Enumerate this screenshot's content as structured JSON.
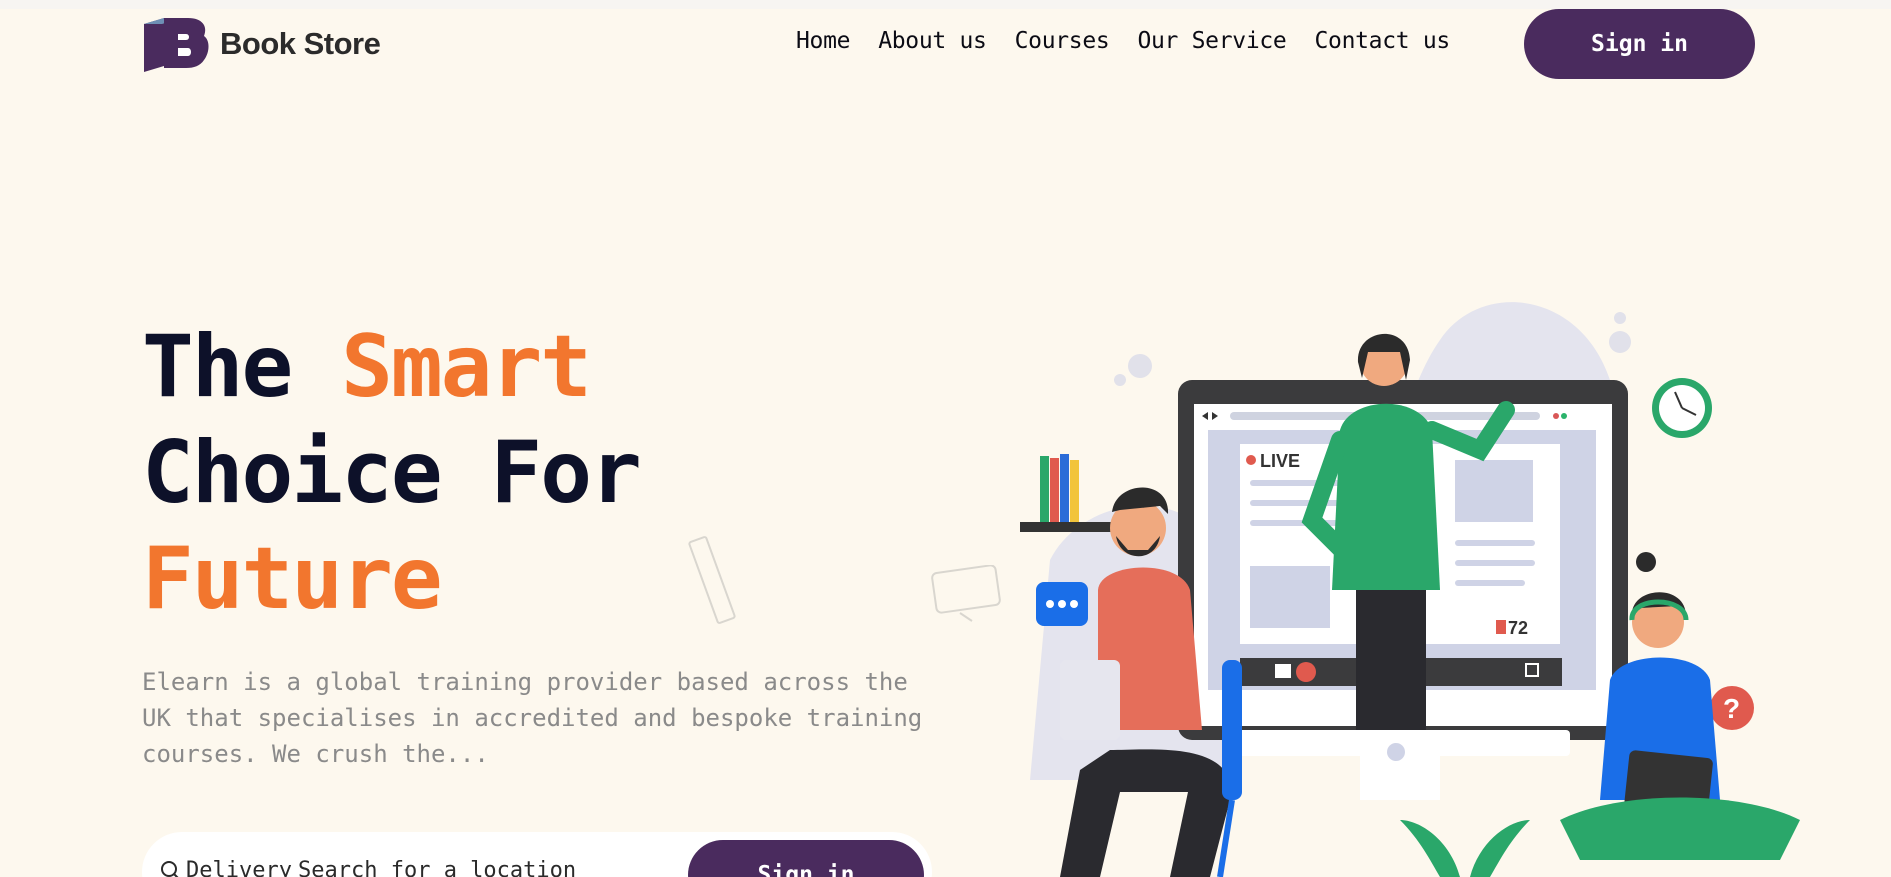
{
  "header": {
    "brand": "Book Store",
    "nav": [
      {
        "label": "Home"
      },
      {
        "label": "About us"
      },
      {
        "label": "Courses"
      },
      {
        "label": "Our Service"
      },
      {
        "label": "Contact us"
      }
    ],
    "signin_label": "Sign in"
  },
  "hero": {
    "title_1": "The ",
    "title_accent_1": "Smart",
    "title_2": "Choice For",
    "title_accent_2": "Future",
    "description": "Elearn is a global training provider based across the UK that specialises in accredited and bespoke training courses. We crush the..."
  },
  "search": {
    "prefix": "Delivery",
    "placeholder": "Search for a location",
    "button_label": "Sign in"
  },
  "illustration": {
    "live_label": "LIVE",
    "viewer_count": "72"
  },
  "colors": {
    "background": "#fdf8ee",
    "brand_purple": "#4a2b5e",
    "accent_orange": "#f2762e",
    "text_dark": "#0d1129"
  }
}
